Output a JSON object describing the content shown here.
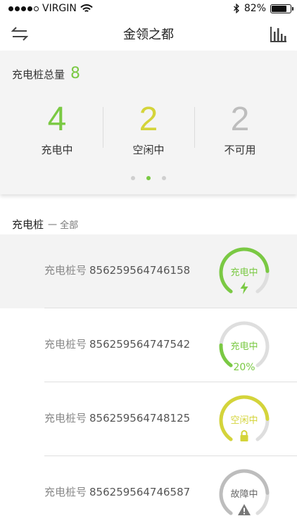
{
  "status_bar": {
    "carrier": "VIRGIN",
    "battery": "82%",
    "battery_level": 0.82
  },
  "nav": {
    "title": "金领之都"
  },
  "summary": {
    "total_label": "充电桩总量",
    "total_value": "8",
    "stats": [
      {
        "value": "4",
        "label": "充电中",
        "color": "#7ac943"
      },
      {
        "value": "2",
        "label": "空闲中",
        "color": "#d4d43a"
      },
      {
        "value": "2",
        "label": "不可用",
        "color": "#bdbdbd"
      }
    ],
    "pager_active_index": 1
  },
  "section": {
    "title": "充电桩",
    "filter": "一 全部"
  },
  "piles": [
    {
      "label": "充电桩号",
      "id": "856259564746158",
      "status": "充电中",
      "color": "#7ac943",
      "progress": 0.8,
      "icon": "lightning-icon",
      "extra": ""
    },
    {
      "label": "充电桩号",
      "id": "856259564747542",
      "status": "充电中",
      "color": "#7ac943",
      "progress": 0.2,
      "icon": "",
      "extra": "20%"
    },
    {
      "label": "充电桩号",
      "id": "856259564748125",
      "status": "空闲中",
      "color": "#d4d43a",
      "progress": 0.8,
      "icon": "lock-icon",
      "extra": ""
    },
    {
      "label": "充电桩号",
      "id": "856259564746587",
      "status": "故障中",
      "color": "#bdbdbd",
      "progress": 0.8,
      "icon": "warning-icon",
      "extra": ""
    }
  ]
}
